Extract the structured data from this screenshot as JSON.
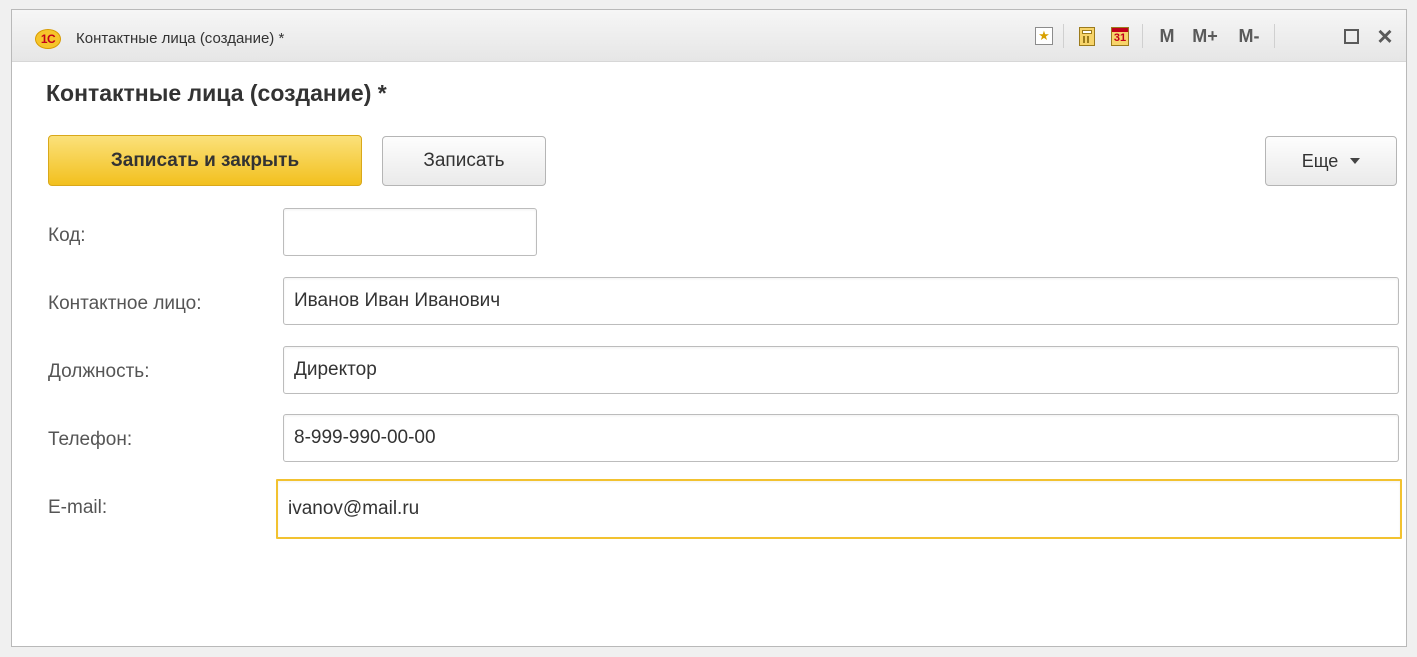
{
  "window": {
    "title": "Контактные лица (создание) *",
    "logo_text": "1С",
    "toolbar_icons": [
      "favorites-icon",
      "calculator-icon",
      "calendar-icon"
    ],
    "calendar_day": "31",
    "memory_buttons": {
      "m": "M",
      "m_plus": "M+",
      "m_minus": "M-"
    },
    "maximize_icon": "maximize-icon",
    "close_icon": "×"
  },
  "form": {
    "title": "Контактные лица (создание) *",
    "buttons": {
      "save_and_close": "Записать и закрыть",
      "save": "Записать",
      "more": "Еще"
    },
    "fields": {
      "code": {
        "label": "Код:",
        "value": ""
      },
      "contact_person": {
        "label": "Контактное лицо:",
        "value": "Иванов Иван Иванович"
      },
      "position": {
        "label": "Должность:",
        "value": "Директор"
      },
      "phone": {
        "label": "Телефон:",
        "value": "8-999-990-00-00"
      },
      "email": {
        "label": "E-mail:",
        "value": "ivanov@mail.ru"
      }
    }
  },
  "colors": {
    "primary_button": "#f2c01e",
    "focus_border": "#f2c230",
    "logo_red": "#c2001a"
  }
}
